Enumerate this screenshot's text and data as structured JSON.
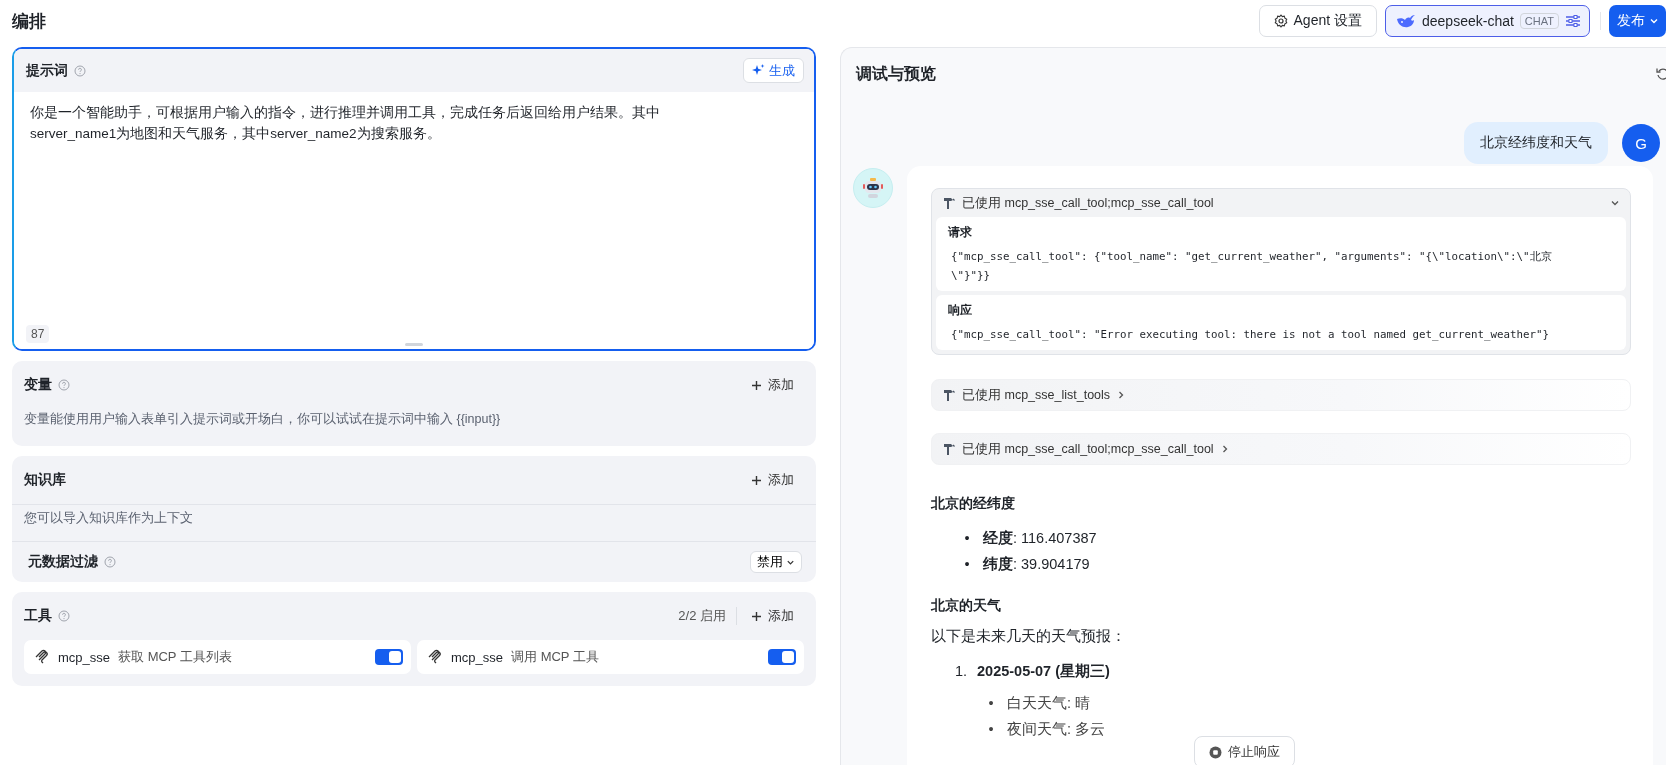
{
  "header": {
    "title": "编排",
    "agent_settings": "Agent 设置",
    "model": {
      "name": "deepseek-chat",
      "badge": "CHAT"
    },
    "publish": "发布"
  },
  "prompt": {
    "title": "提示词",
    "generate": "生成",
    "text": "你是一个智能助手，可根据用户输入的指令，进行推理并调用工具，完成任务后返回给用户结果。其中server_name1为地图和天气服务，其中server_name2为搜索服务。",
    "count": "87"
  },
  "variables": {
    "title": "变量",
    "add": "添加",
    "hint": "变量能使用用户输入表单引入提示词或开场白，你可以试试在提示词中输入 {{input}}"
  },
  "knowledge": {
    "title": "知识库",
    "add": "添加",
    "hint": "您可以导入知识库作为上下文",
    "metadata_filter": {
      "label": "元数据过滤",
      "value": "禁用"
    }
  },
  "tools": {
    "title": "工具",
    "enabled_count": "2/2 启用",
    "add": "添加",
    "items": [
      {
        "provider": "mcp_sse",
        "name": "获取 MCP 工具列表",
        "on": true
      },
      {
        "provider": "mcp_sse",
        "name": "调用 MCP 工具",
        "on": true
      }
    ]
  },
  "preview": {
    "title": "调试与预览",
    "stop": "停止响应",
    "messages": [
      {
        "kind": "user",
        "text": "北京经纬度和天气",
        "avatar": "G"
      },
      {
        "kind": "bot",
        "tool_calls": [
          {
            "label": "已使用 mcp_sse_call_tool;mcp_sse_call_tool",
            "expanded": true,
            "request_title": "请求",
            "request": "{\"mcp_sse_call_tool\": {\"tool_name\": \"get_current_weather\", \"arguments\": \"{\\\"location\\\":\\\"北京\\\"}\"}}",
            "response_title": "响应",
            "response": "{\"mcp_sse_call_tool\": \"Error executing tool: there is not a tool named get_current_weather\"}"
          },
          {
            "label": "已使用 mcp_sse_list_tools",
            "expanded": false
          },
          {
            "label": "已使用 mcp_sse_call_tool;mcp_sse_call_tool",
            "expanded": false
          }
        ],
        "content": [
          {
            "kind": "heading",
            "text": "北京的经纬度"
          },
          {
            "kind": "bullets",
            "items": [
              {
                "marker": "•",
                "text": "**经度**: 116.407387"
              },
              {
                "marker": "•",
                "text": "**纬度**: 39.904179"
              }
            ]
          },
          {
            "kind": "heading",
            "text": "北京的天气"
          },
          {
            "kind": "paragraph",
            "text": "以下是未来几天的天气预报："
          },
          {
            "kind": "ordered",
            "items": [
              {
                "marker": "1.",
                "title": "2025-05-07 (星期三)",
                "children": [
                  {
                    "marker": "•",
                    "text": "白天天气: 晴"
                  },
                  {
                    "marker": "•",
                    "text": "夜间天气: 多云"
                  }
                ]
              }
            ]
          }
        ]
      }
    ]
  }
}
